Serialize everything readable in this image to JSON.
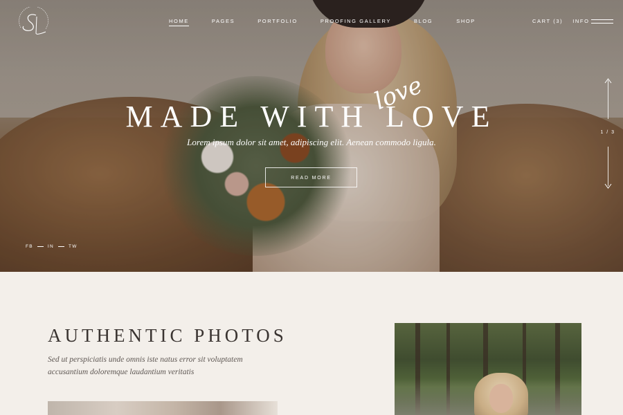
{
  "nav": {
    "items": [
      "HOME",
      "PAGES",
      "PORTFOLIO",
      "PROOFING GALLERY",
      "BLOG",
      "SHOP"
    ],
    "active": "HOME",
    "cart": "CART (3)",
    "info": "INFO"
  },
  "hero": {
    "script_word": "love",
    "title": "MADE WITH LOVE",
    "subtitle": "Lorem ipsum dolor sit amet, adipiscing elit. Aenean commodo ligula.",
    "button": "READ MORE",
    "slide_counter": "1 / 3",
    "social": [
      "FB",
      "IN",
      "TW"
    ]
  },
  "section": {
    "title": "AUTHENTIC PHOTOS",
    "text": "Sed ut perspiciatis unde omnis iste natus error sit voluptatem accusantium doloremque laudantium veritatis"
  },
  "icons": {
    "logo": "monogram-logo",
    "menu": "hamburger-menu-icon",
    "slider_up": "arrow-up-icon",
    "slider_down": "arrow-down-icon"
  },
  "colors": {
    "background": "#f3efea",
    "heading": "#3a3431",
    "hero_text": "#ffffff"
  }
}
